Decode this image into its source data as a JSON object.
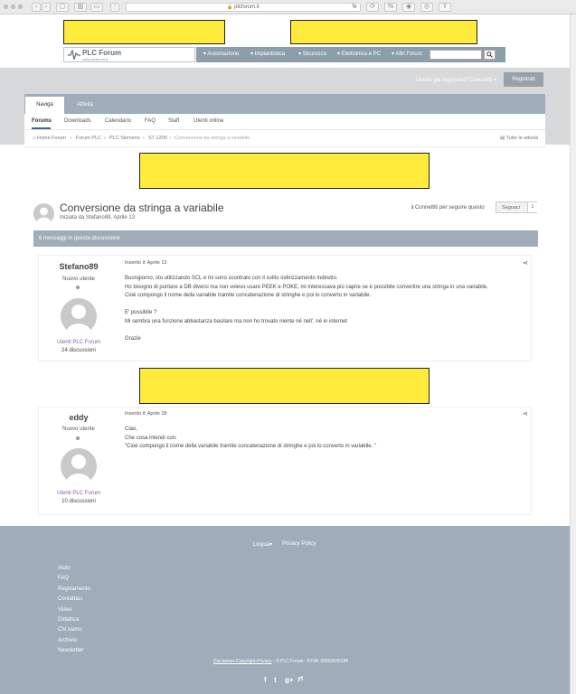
{
  "browser": {
    "url": "plcforum.it",
    "buttons": [
      "‹",
      "›",
      "▢",
      "▥",
      "▭",
      "⋮"
    ],
    "right_buttons": [
      "✕",
      "↻",
      "⟳",
      "%",
      "◉",
      "◎",
      "⇪"
    ]
  },
  "site": {
    "logo_text": "PLC Forum",
    "logo_sub": "www.plcforum.it",
    "nav": [
      "Automazione",
      "Impiantistica",
      "Sicurezza",
      "Elettronica e PC",
      "Altri Forum"
    ],
    "search_placeholder": "",
    "signin_text": "Utente già registrato? Connettiti",
    "register_label": "Registrati"
  },
  "tabs": [
    "Naviga",
    "Attività"
  ],
  "subnav": [
    "Forums",
    "Downloads",
    "Calendario",
    "FAQ",
    "Staff",
    "Utenti online"
  ],
  "breadcrumb": [
    "Home Forum",
    "Forum PLC",
    "PLC Siemens",
    "S7-1200",
    "Conversione da stringa a variabile"
  ],
  "all_activity": "Tutte le attività",
  "topic": {
    "title": "Conversione da stringa a variabile",
    "started_by": "Iniziata da Stefano89, Aprile 13",
    "follow_text": "Connettiti per seguire questo",
    "follow_label": "Seguaci",
    "follow_count": "1",
    "messages_count": "6 messaggi in questa discussione"
  },
  "posts": [
    {
      "author": "Stefano89",
      "role": "Nuovo utente",
      "group": "Utenti PLC Forum",
      "discussions": "24 discussioni",
      "date": "Inserito il: Aprile 13",
      "lines": [
        "Buongiorno, sto utilizzando SCL e mi sono scontrato con il solito indirizzamento indiretto.",
        "Ho bisogno di puntare a DB diversi ma non volevo usare PEEK e POKE, mi interessava più capire se è possibile convertire una stringa in una variabile.",
        "Cioè compongo il nome della variabile tramite concatenazione di stringhe e poi lo converto in variabile.",
        "",
        "E' possibile ?",
        "Mi sembra una funzione abbastanza basilare ma non ho trovato niente né nell'. né in internet",
        "",
        "Grazie"
      ]
    },
    {
      "author": "eddy",
      "role": "Nuovo utente",
      "group": "Utenti PLC Forum",
      "discussions": "10 discussioni",
      "date": "Inserito il: Aprile 28",
      "lines": [
        "Ciao,",
        "Che cosa intendi con:",
        "\"Cioè compongo il nome della variabile tramite concatenazione di stringhe e poi lo converto in variabile. \""
      ]
    }
  ],
  "footer": {
    "language": "Lingua",
    "privacy": "Privacy Policy",
    "links": [
      "Aiuto",
      "FAQ",
      "Regolamento",
      "Contattaci",
      "Video",
      "Didattica",
      "Chi siamo",
      "Archivio",
      "Newsletter"
    ],
    "disclaimer_link": "Disclaimer-Copyright-Privacy",
    "copyright": " - © PLC Forum - P.IVA: 00650640186",
    "social": [
      "f",
      "t",
      "g+",
      "yt"
    ]
  }
}
